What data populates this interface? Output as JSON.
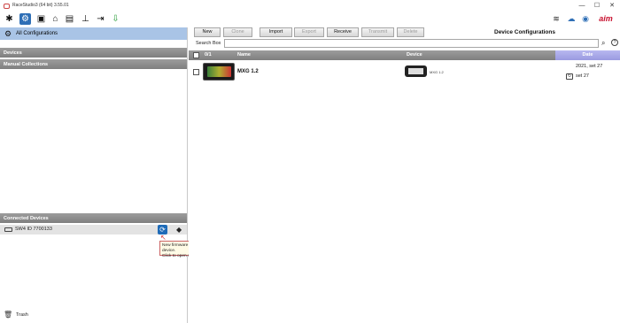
{
  "window": {
    "title": "RaceStudio3 (64 bit) 3.55.01",
    "controls": {
      "minimize": "—",
      "maximize": "☐",
      "close": "✕"
    }
  },
  "toolbar": {
    "icons": [
      "wrench-icon",
      "configurations-icon",
      "analysis-icon",
      "tracks-icon",
      "video-icon",
      "gauge-icon",
      "connect-icon",
      "download-icon"
    ],
    "right": {
      "wifi_label": "",
      "cloud_label": "",
      "rs3_label": "RS3",
      "brand": "aim"
    }
  },
  "left_panel": {
    "all_configurations_label": "All Configurations",
    "devices_section_label": "Devices",
    "manual_collections_label": "Manual Collections",
    "connected_devices_label": "Connected Devices",
    "connected_device": {
      "name": "SW4 ID 7700133"
    },
    "tooltip": {
      "line1": "New firmware is available for your device.",
      "line2": "Click to open web updates window."
    },
    "trash_label": "Trash"
  },
  "right_panel": {
    "buttons": {
      "new": "New",
      "clone": "Clone",
      "import": "Import",
      "export": "Export",
      "receive": "Receive",
      "transmit": "Transmit",
      "delete": "Delete"
    },
    "title": "Device Configurations",
    "search": {
      "label": "Search Box",
      "value": ""
    },
    "table": {
      "headers": {
        "count": "0/1",
        "name": "Name",
        "device": "Device",
        "date": "Date"
      },
      "rows": [
        {
          "name": "MXG 1.2",
          "device_label": "MXG 1.2",
          "date_line1": "2021, set 27",
          "date_line2": "set 27"
        }
      ]
    }
  },
  "colors": {
    "accent_blue": "#2f6fb6",
    "selected_row": "#a9c4e6",
    "header_gray": "#8c8c8c",
    "date_header": "#a8a8e8",
    "tooltip_bg": "#fffbe6"
  }
}
